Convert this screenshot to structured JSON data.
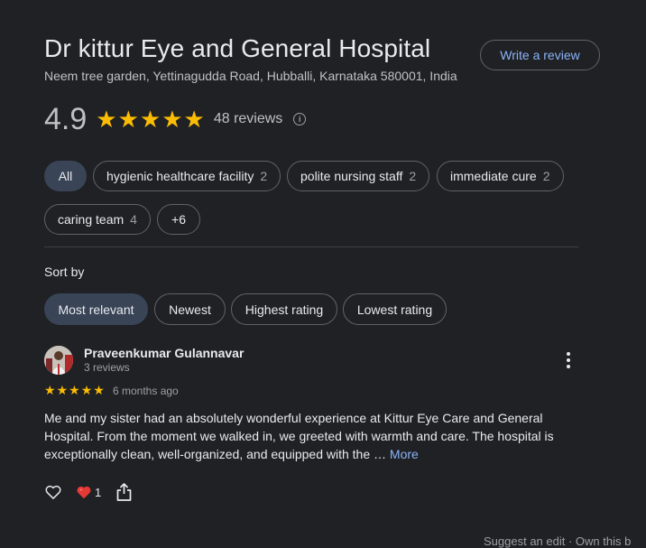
{
  "place": {
    "name": "Dr kittur Eye and General Hospital",
    "address": "Neem tree garden, Yettinagudda Road, Hubballi, Karnataka 580001, India",
    "write_review_label": "Write a review",
    "rating": "4.9",
    "stars": 5,
    "review_count_label": "48 reviews",
    "info_icon": "info-icon"
  },
  "topics": [
    {
      "label": "All",
      "count": "",
      "selected": true
    },
    {
      "label": "hygienic healthcare facility",
      "count": "2"
    },
    {
      "label": "polite nursing staff",
      "count": "2"
    },
    {
      "label": "immediate cure",
      "count": "2"
    },
    {
      "label": "caring team",
      "count": "4"
    },
    {
      "label": "+6",
      "count": ""
    }
  ],
  "sort": {
    "label": "Sort by",
    "options": [
      "Most relevant",
      "Newest",
      "Highest rating",
      "Lowest rating"
    ],
    "selected": "Most relevant"
  },
  "review": {
    "reviewer_name": "Praveenkumar Gulannavar",
    "reviewer_meta": "3 reviews",
    "stars": 5,
    "time": "6 months ago",
    "text": "Me and my sister had an absolutely wonderful experience at Kittur Eye Care and General Hospital. From the moment we walked in, we greeted with warmth and care. The hospital is exceptionally clean, well-organized, and equipped with the … ",
    "more_label": "More",
    "reaction_count": "1",
    "icons": [
      "thumbs-up-icon",
      "heart-icon",
      "share-icon",
      "more-vert-icon"
    ]
  },
  "footer": {
    "text": "Suggest an edit · Own this b"
  },
  "colors": {
    "background": "#202124",
    "accent": "#8ab4f8",
    "star": "#fbbc04",
    "chip_selected": "#394457"
  }
}
